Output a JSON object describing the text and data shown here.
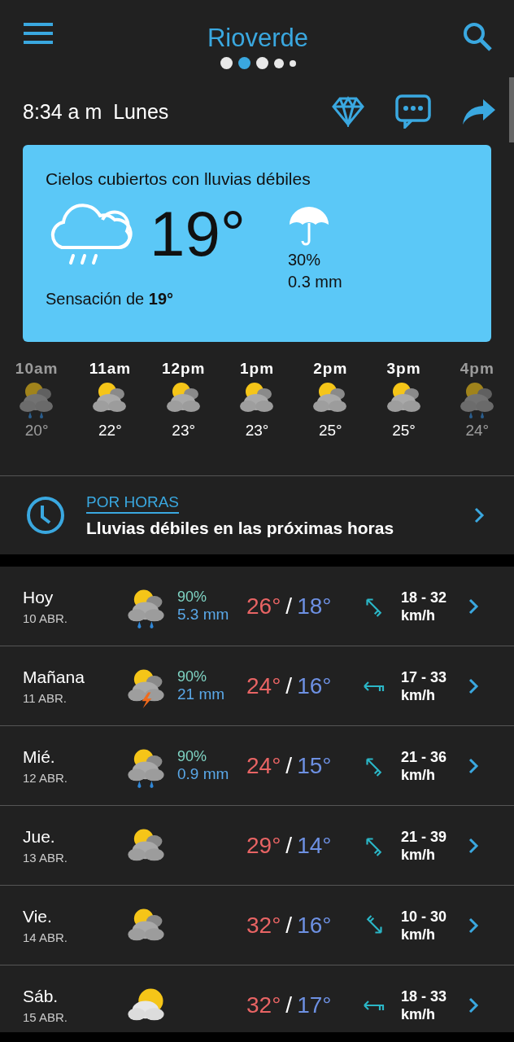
{
  "header": {
    "title": "Rioverde",
    "page_dots": [
      {
        "selected": false
      },
      {
        "selected": true
      },
      {
        "selected": false
      },
      {
        "selected": false
      },
      {
        "selected": false
      }
    ]
  },
  "now": {
    "time_day": "8:34 a m  Lunes"
  },
  "current": {
    "summary": "Cielos cubiertos con lluvias débiles",
    "kind": "rain_outline",
    "temperature": "19°",
    "precip_probability": "30%",
    "precip_amount": "0.3 mm",
    "feels_like": "Sensación de **19°**"
  },
  "hourly": [
    {
      "time": "10am",
      "kind": "rain",
      "temp": "20°",
      "dimmed": true
    },
    {
      "time": "11am",
      "kind": "cloudy_sun",
      "temp": "22°",
      "dimmed": false
    },
    {
      "time": "12pm",
      "kind": "cloudy_sun",
      "temp": "23°",
      "dimmed": false
    },
    {
      "time": "1pm",
      "kind": "cloudy_sun",
      "temp": "23°",
      "dimmed": false
    },
    {
      "time": "2pm",
      "kind": "cloudy_sun",
      "temp": "25°",
      "dimmed": false
    },
    {
      "time": "3pm",
      "kind": "cloudy_sun",
      "temp": "25°",
      "dimmed": false
    },
    {
      "time": "4pm",
      "kind": "rain",
      "temp": "24°",
      "dimmed": true
    }
  ],
  "hourly_link": {
    "label": "POR HORAS",
    "text": "Lluvias débiles en las próximas horas"
  },
  "days": [
    {
      "day": "Hoy",
      "date": "10 ABR.",
      "weather": {
        "kind": "rain"
      },
      "probability": "90%",
      "amount": "5.3 mm",
      "high": "26°",
      "separator": "/",
      "low": "18°",
      "wind_arrow": {
        "kind": "nw"
      },
      "wind": "18 - 32",
      "wind_unit": "km/h"
    },
    {
      "day": "Mañana",
      "date": "11 ABR.",
      "weather": {
        "kind": "storm"
      },
      "probability": "90%",
      "amount": "21 mm",
      "high": "24°",
      "separator": "/",
      "low": "16°",
      "wind_arrow": {
        "kind": "w"
      },
      "wind": "17 - 33",
      "wind_unit": "km/h"
    },
    {
      "day": "Mié.",
      "date": "12 ABR.",
      "weather": {
        "kind": "rain"
      },
      "probability": "90%",
      "amount": "0.9 mm",
      "high": "24°",
      "separator": "/",
      "low": "15°",
      "wind_arrow": {
        "kind": "nw"
      },
      "wind": "21 - 36",
      "wind_unit": "km/h"
    },
    {
      "day": "Jue.",
      "date": "13 ABR.",
      "weather": {
        "kind": "cloudy_sun"
      },
      "high": "29°",
      "separator": "/",
      "low": "14°",
      "wind_arrow": {
        "kind": "nw"
      },
      "wind": "21 - 39",
      "wind_unit": "km/h"
    },
    {
      "day": "Vie.",
      "date": "14 ABR.",
      "weather": {
        "kind": "cloudy_sun"
      },
      "high": "32°",
      "separator": "/",
      "low": "16°",
      "wind_arrow": {
        "kind": "se"
      },
      "wind": "10 - 30",
      "wind_unit": "km/h"
    },
    {
      "day": "Sáb.",
      "date": "15 ABR.",
      "weather": {
        "kind": "sun_cloud"
      },
      "high": "32°",
      "separator": "/",
      "low": "17°",
      "wind_arrow": {
        "kind": "w"
      },
      "wind": "18 - 33",
      "wind_unit": "km/h"
    }
  ]
}
